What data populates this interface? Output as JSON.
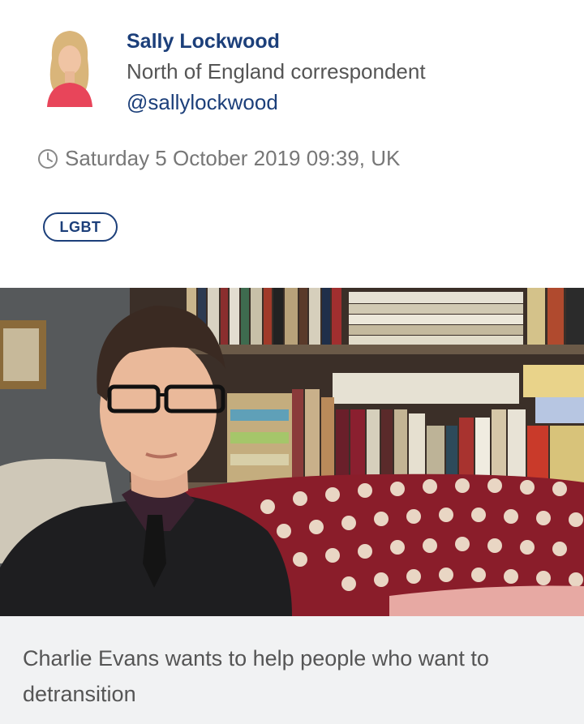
{
  "author": {
    "name": "Sally Lockwood",
    "role": "North of England correspondent",
    "handle": "@sallylockwood"
  },
  "meta": {
    "timestamp": "Saturday 5 October 2019 09:39, UK",
    "clock_icon": "clock-icon"
  },
  "tags": [
    "LGBT"
  ],
  "hero": {
    "caption": "Charlie Evans wants to help people who want to detransition"
  },
  "colors": {
    "brand_blue": "#1c3f7a",
    "caption_bg": "#f1f2f3",
    "text_grey": "#555555"
  }
}
